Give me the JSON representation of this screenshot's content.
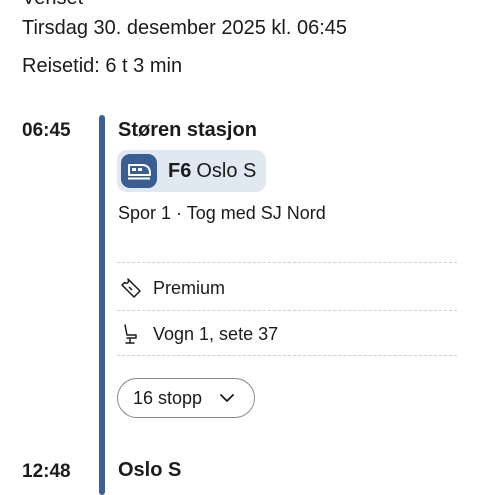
{
  "header": {
    "cut_text": "Venset",
    "date_line": "Tirsdag 30. desember 2025 kl. 06:45",
    "duration_line": "Reisetid: 6 t 3 min"
  },
  "departure": {
    "time": "06:45",
    "station": "Støren stasjon",
    "line_code": "F6",
    "line_destination": "Oslo S",
    "platform_info": "Spor 1 · Tog med SJ Nord",
    "ticket_class": "Premium",
    "seat": "Vogn 1, sete 37",
    "stops_button": "16 stopp"
  },
  "arrival": {
    "time": "12:48",
    "station": "Oslo S"
  },
  "colors": {
    "rail": "#3c5f94",
    "badge_bg": "#e0e8f2",
    "train_icon_bg": "#3a5e91"
  },
  "icons": {
    "train": "train-icon",
    "ticket": "ticket-icon",
    "seat": "seat-icon",
    "chevron": "chevron-down-icon"
  }
}
